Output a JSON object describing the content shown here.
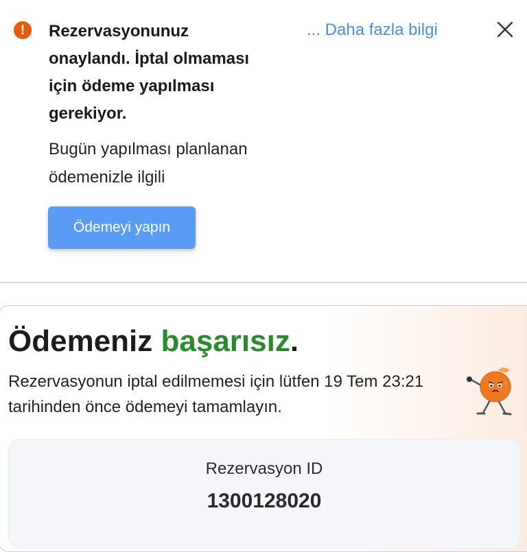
{
  "banner": {
    "icon": "exclamation-alert-icon",
    "icon_glyph": "!",
    "icon_color": "#e8590c",
    "title": "Rezervasyonunuz onaylandı. İptal olmaması için ödeme yapılması gerekiyor.",
    "more_link": "... Daha fazla bilgi",
    "body": "Bugün yapılması planlanan ödemenizle ilgili",
    "pay_button": "Ödemeyi yapın",
    "close_icon": "close-icon"
  },
  "payment_status": {
    "heading_prefix": "Ödemeniz ",
    "heading_status": "başarısız",
    "heading_suffix": ".",
    "status_color": "#2b8a2e",
    "description": "Rezervasyonun iptal edilmemesi için lütfen 19 Tem 23:21 tarihinden önce ödemeyi tamamlayın.",
    "mascot": "orange-character-mascot-icon"
  },
  "reservation": {
    "id_label": "Rezervasyon ID",
    "id_value": "1300128020"
  }
}
